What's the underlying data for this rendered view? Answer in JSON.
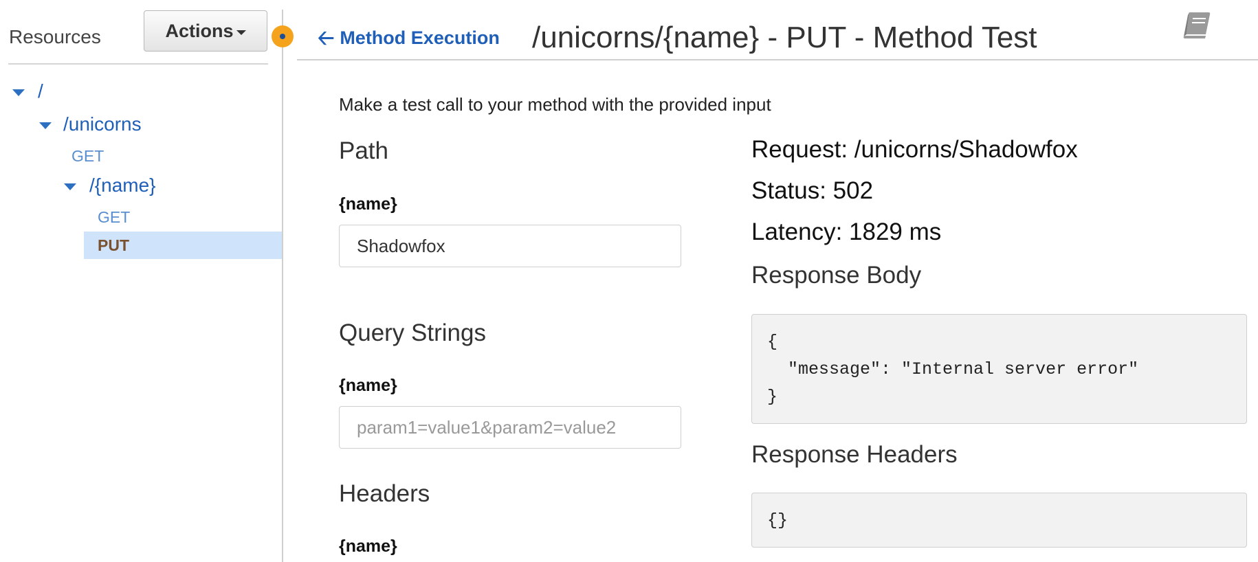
{
  "sidebar": {
    "title": "Resources",
    "actions_label": "Actions",
    "tree": {
      "root": "/",
      "unicorns": "/unicorns",
      "unicorns_get": "GET",
      "name": "/{name}",
      "name_get": "GET",
      "name_put": "PUT"
    }
  },
  "header": {
    "back_label": "Method Execution",
    "title": "/unicorns/{name} - PUT - Method Test"
  },
  "main": {
    "intro": "Make a test call to your method with the provided input",
    "path_title": "Path",
    "path_param_label": "{name}",
    "path_param_value": "Shadowfox",
    "query_title": "Query Strings",
    "query_param_label": "{name}",
    "query_placeholder": "param1=value1&param2=value2",
    "headers_title": "Headers",
    "headers_param_label": "{name}"
  },
  "response": {
    "request": "Request: /unicorns/Shadowfox",
    "status": "Status: 502",
    "latency": "Latency: 1829 ms",
    "body_title": "Response Body",
    "body": "{\n  \"message\": \"Internal server error\"\n}",
    "headers_title": "Response Headers",
    "headers": "{}"
  },
  "colors": {
    "link": "#1f5fb8",
    "selected_bg": "#cfe3fb",
    "selected_text": "#7a5230",
    "handle": "#f5a21c"
  },
  "icons": {
    "back": "arrow-left-icon",
    "docs": "book-icon",
    "tree": "caret-down-icon"
  }
}
